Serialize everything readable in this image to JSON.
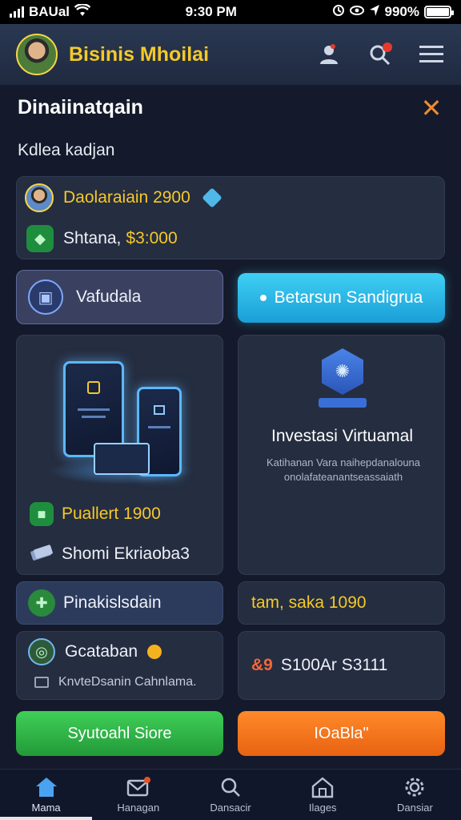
{
  "status": {
    "carrier": "BAUal",
    "time": "9:30 PM",
    "battery": "990%"
  },
  "appbar": {
    "title": "Bisinis Mhoilai"
  },
  "section": {
    "title": "Dinaiinatqain",
    "subtitle": "Kdlea kadjan"
  },
  "balance": {
    "primary": "Daolaraiain 2900",
    "secondary_label": "Shtana,",
    "secondary_value": "$3:000"
  },
  "actions": {
    "left_label": "Vafudala",
    "right_label": "Betarsun Sandigrua"
  },
  "left_card": {
    "stat1": "Puallert 1900",
    "stat2": "Shomi Ekriaoba3"
  },
  "invest": {
    "title": "Investasi Virtuamal",
    "description": "Katihanan Vara naihepdanalouna onolafateanantseassaiath"
  },
  "row2": {
    "left": "Pinakislsdain",
    "right": "tam, saka 1090"
  },
  "row3": {
    "left_title": "Gcataban",
    "left_sub": "KnvteDsanin Cahnlama.",
    "right_prefix": "&9",
    "right_value": "S100Ar S3111"
  },
  "buttons": {
    "green": "Syutoahl Siore",
    "orange": "IOaBla\""
  },
  "nav": [
    {
      "label": "Mama",
      "icon": "home-icon"
    },
    {
      "label": "Hanagan",
      "icon": "mail-icon"
    },
    {
      "label": "Dansacir",
      "icon": "search-icon"
    },
    {
      "label": "Ilages",
      "icon": "house-icon"
    },
    {
      "label": "Dansiar",
      "icon": "gear-icon"
    }
  ],
  "colors": {
    "accent_yellow": "#f5c928",
    "cyan": "#3fd0f4",
    "green": "#3fcf58",
    "orange": "#ff8a2a",
    "background": "#141a2b"
  }
}
